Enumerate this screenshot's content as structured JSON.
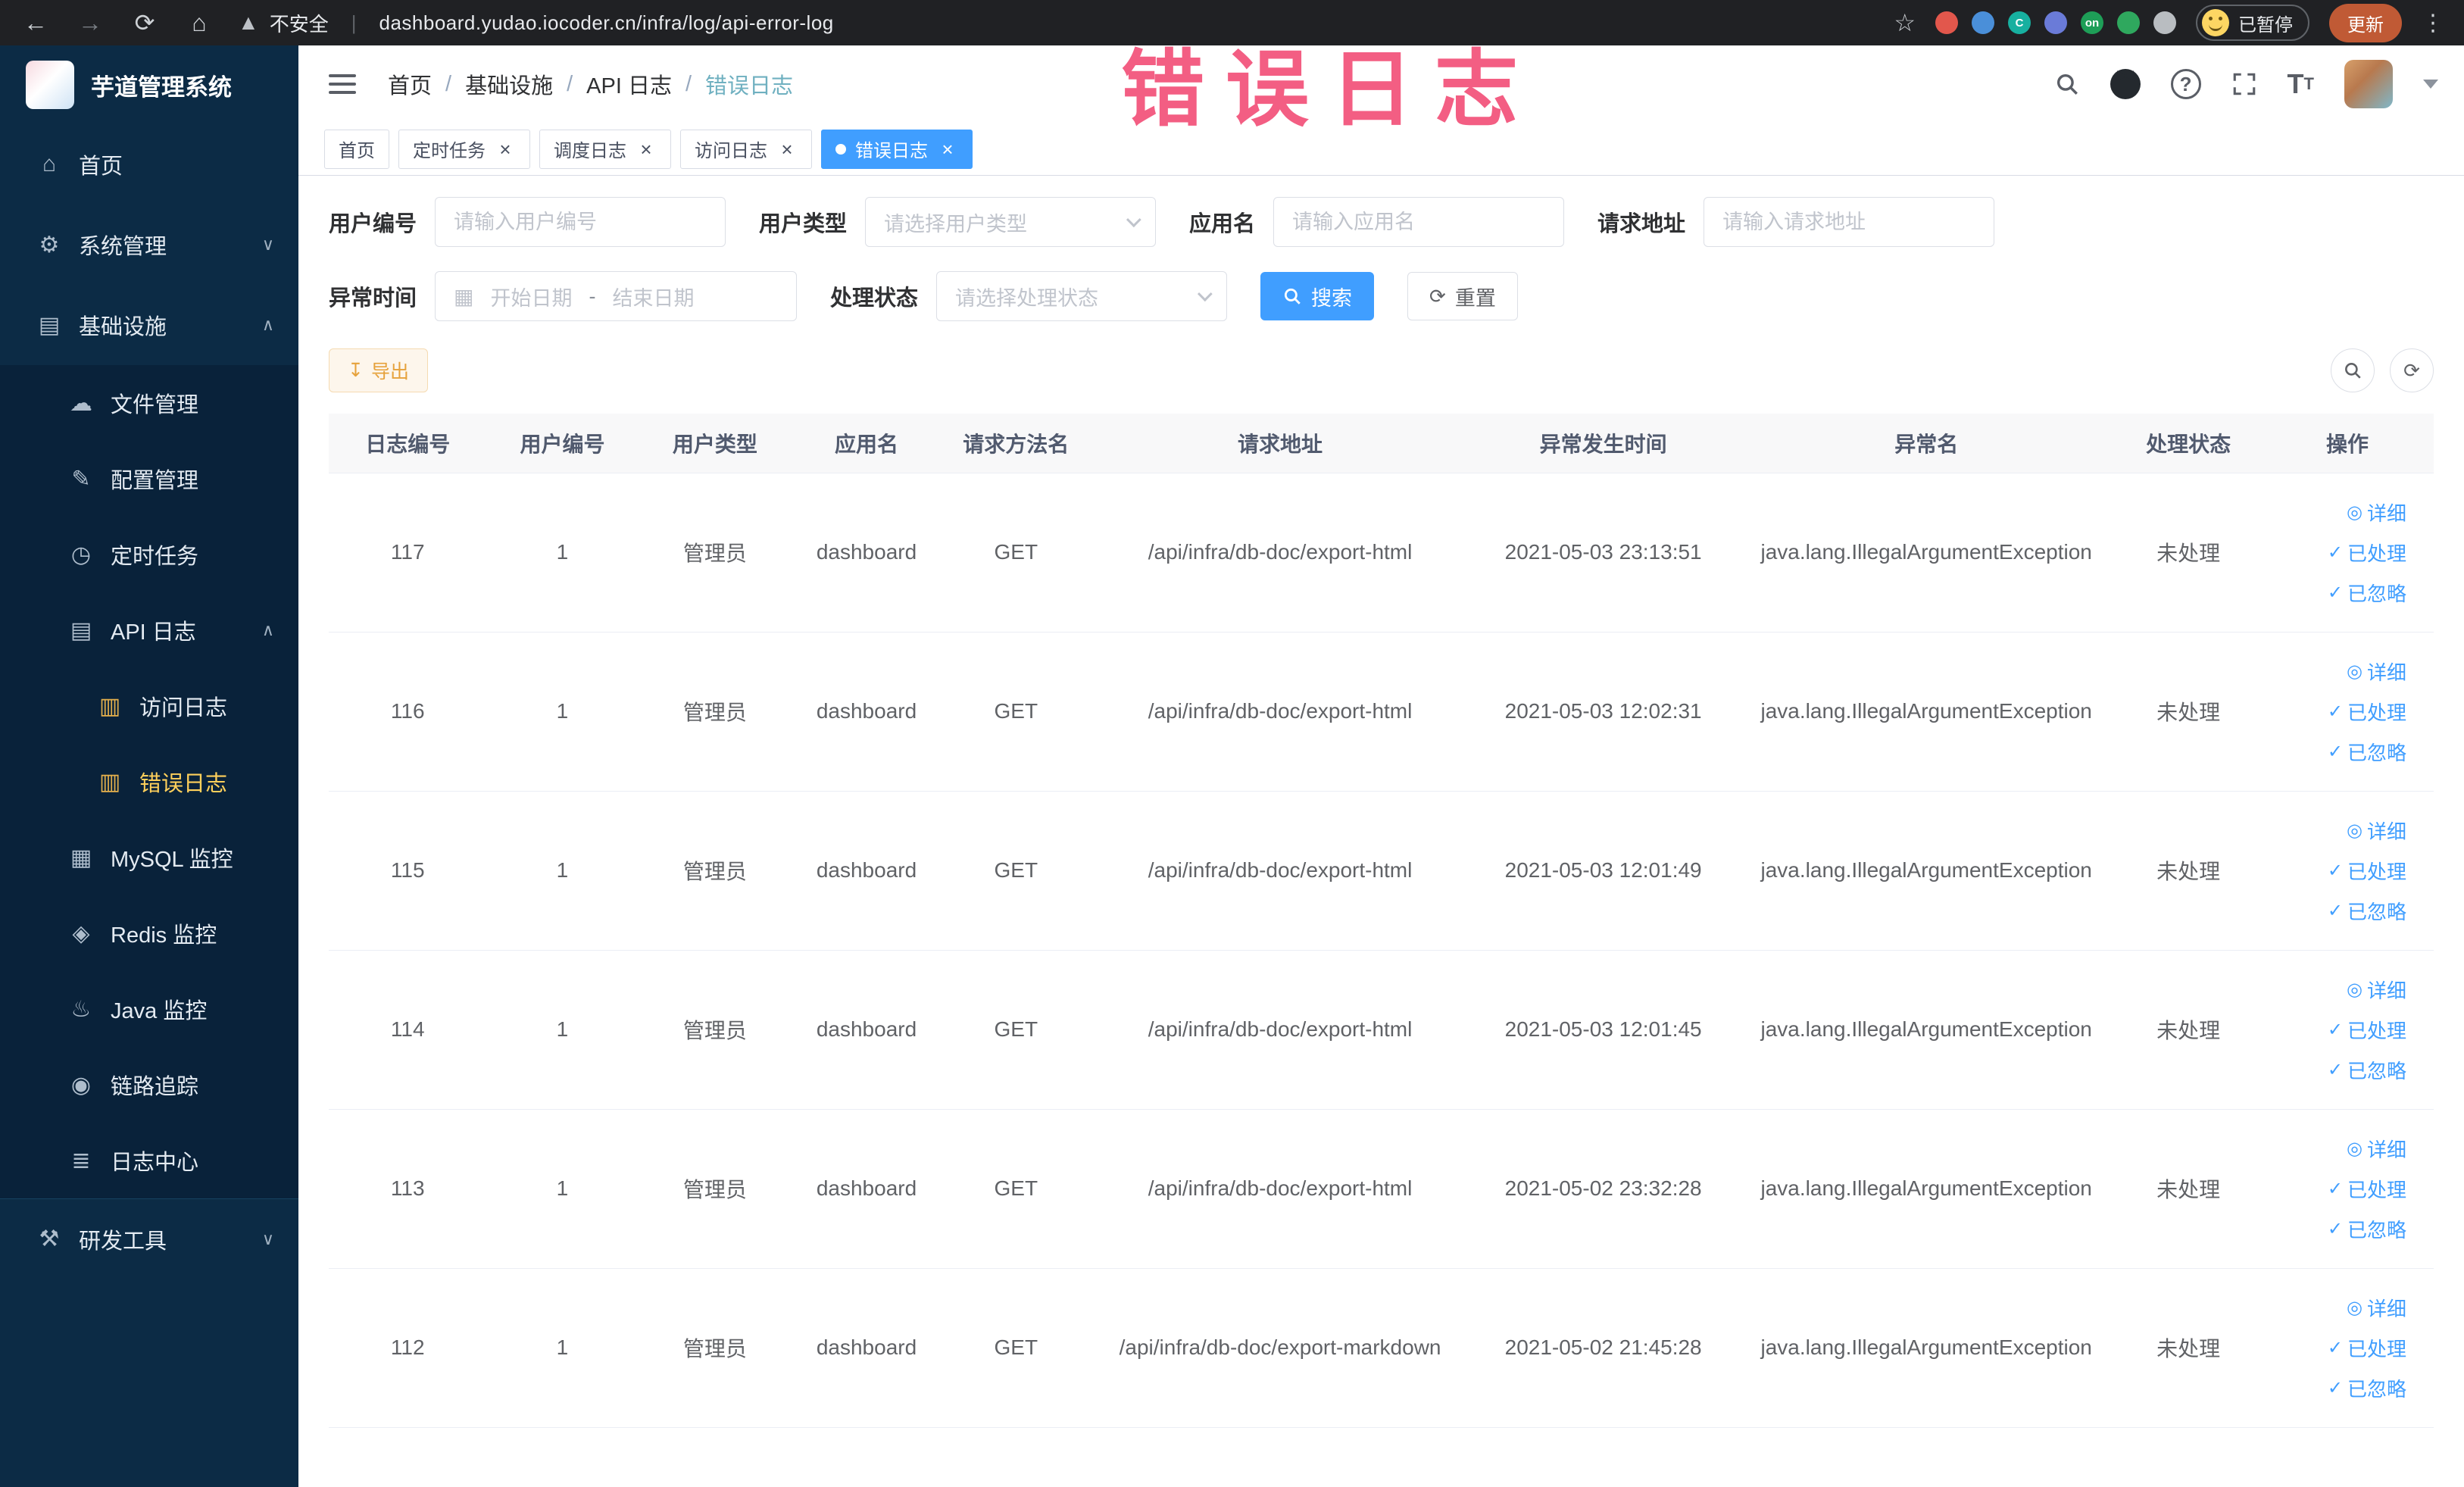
{
  "colors": {
    "primary": "#409eff",
    "sidebar_bg": "#0c2b45",
    "menu_active": "#ffd05b",
    "annotation": "#f3527a",
    "warning": "#e6a23c"
  },
  "browser": {
    "security_label": "不安全",
    "url": "dashboard.yudao.iocoder.cn/infra/log/api-error-log",
    "paused_badge": "已暂停",
    "update_button": "更新",
    "extensions": [
      {
        "key": "red-circle",
        "color": "#e2574c",
        "label": ""
      },
      {
        "key": "blue-drop",
        "color": "#4a8fd9",
        "label": ""
      },
      {
        "key": "teal-circle",
        "color": "#17b0a0",
        "label": "C"
      },
      {
        "key": "puzzle",
        "color": "#6a7bd8",
        "label": ""
      },
      {
        "key": "on-badge",
        "color": "#1e9e57",
        "label": "on"
      },
      {
        "key": "leaf",
        "color": "#2fa85e",
        "label": ""
      },
      {
        "key": "pushpin",
        "color": "#b9bdc1",
        "label": ""
      }
    ]
  },
  "annotation": {
    "text": "错误日志"
  },
  "sidebar": {
    "title": "芋道管理系统",
    "items": [
      {
        "key": "home",
        "label": "首页",
        "icon": "home-icon",
        "level": 1
      },
      {
        "key": "system",
        "label": "系统管理",
        "icon": "gear-icon",
        "level": 1,
        "chevron": "down"
      },
      {
        "key": "infra",
        "label": "基础设施",
        "icon": "infra-icon",
        "level": 1,
        "chevron": "up"
      },
      {
        "key": "file",
        "label": "文件管理",
        "icon": "file-icon",
        "level": 2
      },
      {
        "key": "config",
        "label": "配置管理",
        "icon": "config-icon",
        "level": 2
      },
      {
        "key": "job",
        "label": "定时任务",
        "icon": "schedule-icon",
        "level": 2
      },
      {
        "key": "api-log",
        "label": "API 日志",
        "icon": "api-log-icon",
        "level": 2,
        "chevron": "up"
      },
      {
        "key": "access-log",
        "label": "访问日志",
        "icon": "access-log-icon",
        "level": 3
      },
      {
        "key": "error-log",
        "label": "错误日志",
        "icon": "error-log-icon",
        "level": 3,
        "active": true
      },
      {
        "key": "mysql",
        "label": "MySQL 监控",
        "icon": "mysql-icon",
        "level": 2
      },
      {
        "key": "redis",
        "label": "Redis 监控",
        "icon": "redis-icon",
        "level": 2
      },
      {
        "key": "java",
        "label": "Java 监控",
        "icon": "java-icon",
        "level": 2
      },
      {
        "key": "trace",
        "label": "链路追踪",
        "icon": "trace-icon",
        "level": 2
      },
      {
        "key": "log-center",
        "label": "日志中心",
        "icon": "log-center-icon",
        "level": 2
      },
      {
        "key": "devtools",
        "label": "研发工具",
        "icon": "devtools-icon",
        "level": 1,
        "chevron": "down",
        "divider": true
      }
    ]
  },
  "header": {
    "breadcrumb": [
      "首页",
      "基础设施",
      "API 日志",
      "错误日志"
    ]
  },
  "tabs": [
    {
      "label": "首页",
      "closable": false,
      "active": false
    },
    {
      "label": "定时任务",
      "closable": true,
      "active": false
    },
    {
      "label": "调度日志",
      "closable": true,
      "active": false
    },
    {
      "label": "访问日志",
      "closable": true,
      "active": false
    },
    {
      "label": "错误日志",
      "closable": true,
      "active": true
    }
  ],
  "filters": {
    "user_id": {
      "label": "用户编号",
      "placeholder": "请输入用户编号"
    },
    "user_type": {
      "label": "用户类型",
      "placeholder": "请选择用户类型"
    },
    "app_name": {
      "label": "应用名",
      "placeholder": "请输入应用名"
    },
    "request_url": {
      "label": "请求地址",
      "placeholder": "请输入请求地址"
    },
    "exception_time": {
      "label": "异常时间",
      "start_placeholder": "开始日期",
      "separator": "-",
      "end_placeholder": "结束日期"
    },
    "process_status": {
      "label": "处理状态",
      "placeholder": "请选择处理状态"
    },
    "search_button": "搜索",
    "reset_button": "重置"
  },
  "toolbar": {
    "export_button": "导出"
  },
  "table": {
    "columns": [
      "日志编号",
      "用户编号",
      "用户类型",
      "应用名",
      "请求方法名",
      "请求地址",
      "异常发生时间",
      "异常名",
      "处理状态",
      "操作"
    ],
    "actions": [
      "详细",
      "已处理",
      "已忽略"
    ],
    "rows": [
      {
        "id": "117",
        "user_id": "1",
        "user_type": "管理员",
        "app": "dashboard",
        "method": "GET",
        "url": "/api/infra/db-doc/export-html",
        "time": "2021-05-03 23:13:51",
        "exception": "java.lang.IllegalArgumentException",
        "status": "未处理"
      },
      {
        "id": "116",
        "user_id": "1",
        "user_type": "管理员",
        "app": "dashboard",
        "method": "GET",
        "url": "/api/infra/db-doc/export-html",
        "time": "2021-05-03 12:02:31",
        "exception": "java.lang.IllegalArgumentException",
        "status": "未处理"
      },
      {
        "id": "115",
        "user_id": "1",
        "user_type": "管理员",
        "app": "dashboard",
        "method": "GET",
        "url": "/api/infra/db-doc/export-html",
        "time": "2021-05-03 12:01:49",
        "exception": "java.lang.IllegalArgumentException",
        "status": "未处理"
      },
      {
        "id": "114",
        "user_id": "1",
        "user_type": "管理员",
        "app": "dashboard",
        "method": "GET",
        "url": "/api/infra/db-doc/export-html",
        "time": "2021-05-03 12:01:45",
        "exception": "java.lang.IllegalArgumentException",
        "status": "未处理"
      },
      {
        "id": "113",
        "user_id": "1",
        "user_type": "管理员",
        "app": "dashboard",
        "method": "GET",
        "url": "/api/infra/db-doc/export-html",
        "time": "2021-05-02 23:32:28",
        "exception": "java.lang.IllegalArgumentException",
        "status": "未处理"
      },
      {
        "id": "112",
        "user_id": "1",
        "user_type": "管理员",
        "app": "dashboard",
        "method": "GET",
        "url": "/api/infra/db-doc/export-markdown",
        "time": "2021-05-02 21:45:28",
        "exception": "java.lang.IllegalArgumentException",
        "status": "未处理"
      }
    ]
  }
}
